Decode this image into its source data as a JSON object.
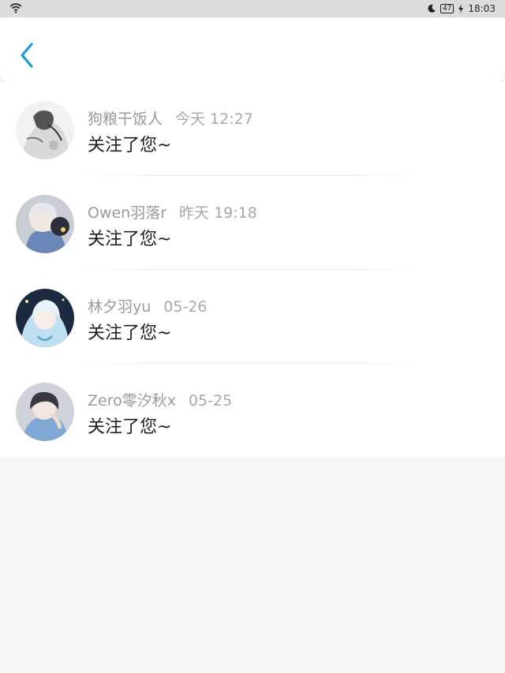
{
  "status_bar": {
    "battery": "47",
    "time": "18:03"
  },
  "header": {
    "back_icon": "chevron-left-icon",
    "accent_color": "#1a9bdb"
  },
  "notifications": [
    {
      "name": "狗粮干饭人",
      "time": "今天 12:27",
      "message": "关注了您~",
      "avatar": "avatar-sketch-icon"
    },
    {
      "name": "Owen羽落r",
      "time": "昨天 19:18",
      "message": "关注了您~",
      "avatar": "avatar-white-hair-icon"
    },
    {
      "name": "林夕羽yu",
      "time": "05-26",
      "message": "关注了您~",
      "avatar": "avatar-blue-hair-icon"
    },
    {
      "name": "Zero零汐秋x",
      "time": "05-25",
      "message": "关注了您~",
      "avatar": "avatar-dark-hair-icon"
    }
  ]
}
